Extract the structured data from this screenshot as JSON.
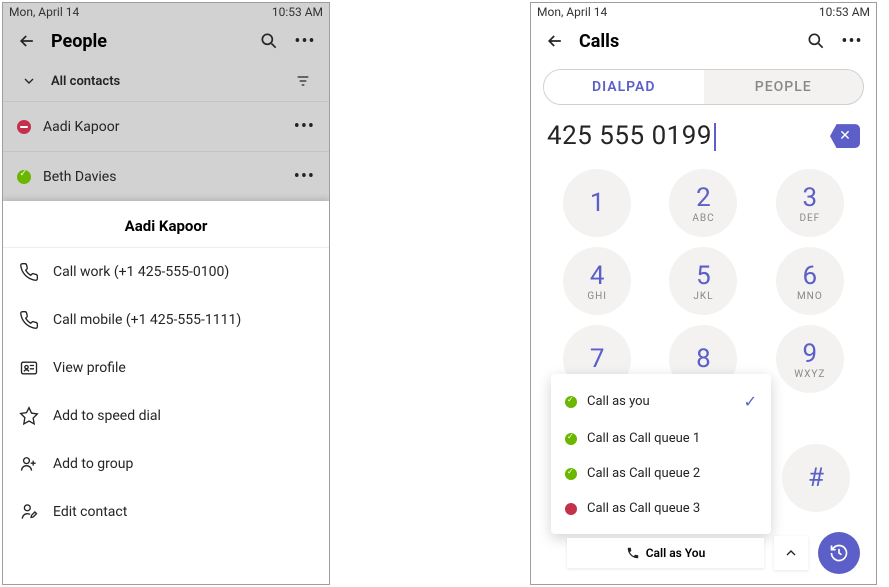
{
  "status": {
    "date": "Mon, April 14",
    "time": "10:53 AM"
  },
  "left": {
    "header": {
      "title": "People"
    },
    "subheader": {
      "label": "All contacts"
    },
    "contacts": [
      {
        "name": "Aadi Kapoor",
        "presence": "dnd"
      },
      {
        "name": "Beth Davies",
        "presence": "available"
      }
    ],
    "sheet": {
      "title": "Aadi Kapoor",
      "items": [
        {
          "icon": "phone",
          "label": "Call work (+1 425-555-0100)"
        },
        {
          "icon": "phone",
          "label": "Call mobile (+1 425-555-1111)"
        },
        {
          "icon": "card",
          "label": "View profile"
        },
        {
          "icon": "star",
          "label": "Add to speed dial"
        },
        {
          "icon": "group",
          "label": "Add to group"
        },
        {
          "icon": "edit",
          "label": "Edit contact"
        }
      ]
    }
  },
  "right": {
    "header": {
      "title": "Calls"
    },
    "tabs": {
      "dialpad": "DIALPAD",
      "people": "PEOPLE"
    },
    "number": "425 555 0199",
    "keys": [
      {
        "num": "1",
        "sub": ""
      },
      {
        "num": "2",
        "sub": "ABC"
      },
      {
        "num": "3",
        "sub": "DEF"
      },
      {
        "num": "4",
        "sub": "GHI"
      },
      {
        "num": "5",
        "sub": "JKL"
      },
      {
        "num": "6",
        "sub": "MNO"
      },
      {
        "num": "7",
        "sub": ""
      },
      {
        "num": "8",
        "sub": ""
      },
      {
        "num": "9",
        "sub": "WXYZ"
      }
    ],
    "hash": "#",
    "popup": {
      "items": [
        {
          "label": "Call as you",
          "status": "green",
          "selected": true
        },
        {
          "label": "Call as Call queue 1",
          "status": "green",
          "selected": false
        },
        {
          "label": "Call as Call queue 2",
          "status": "green",
          "selected": false
        },
        {
          "label": "Call as Call queue 3",
          "status": "red",
          "selected": false
        }
      ]
    },
    "callAsButton": "Call as You"
  }
}
